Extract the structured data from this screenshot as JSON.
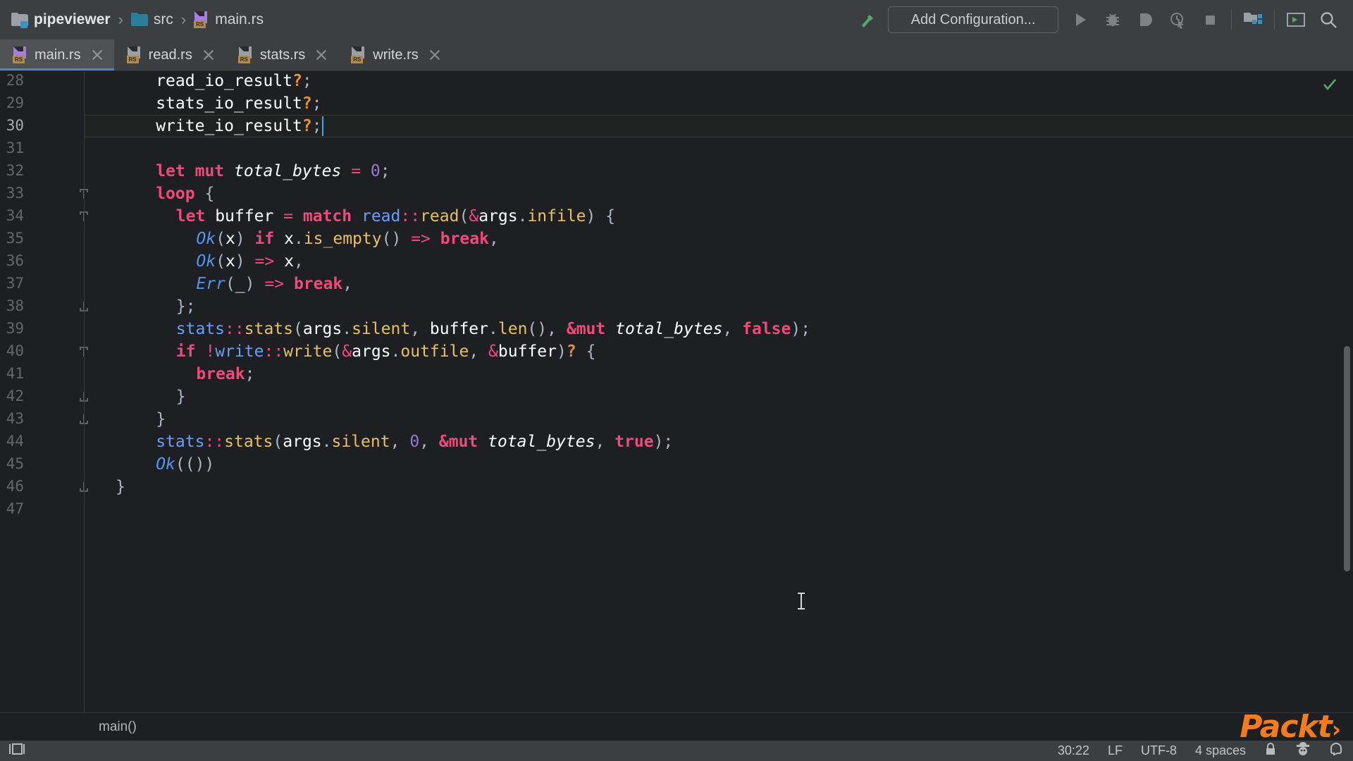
{
  "toolbar": {
    "breadcrumb": [
      {
        "label": "pipeviewer",
        "icon": "module-folder-icon",
        "bold": true
      },
      {
        "label": "src",
        "icon": "folder-icon",
        "bold": false
      },
      {
        "label": "main.rs",
        "icon": "rust-file-icon",
        "bold": false
      }
    ],
    "separator": "›",
    "run_config_label": "Add Configuration...",
    "icons": [
      "build-hammer-icon",
      "run-icon",
      "debug-icon",
      "run-coverage-icon",
      "profile-icon",
      "stop-icon",
      "project-structure-icon",
      "terminal-icon",
      "search-everywhere-icon"
    ]
  },
  "tabs": [
    {
      "label": "main.rs",
      "active": true,
      "icon": "rust-file-icon"
    },
    {
      "label": "read.rs",
      "active": false,
      "icon": "rust-file-icon"
    },
    {
      "label": "stats.rs",
      "active": false,
      "icon": "rust-file-icon"
    },
    {
      "label": "write.rs",
      "active": false,
      "icon": "rust-file-icon"
    }
  ],
  "editor": {
    "file_icon_label": "RS",
    "first_line": 28,
    "current_line": 30,
    "caret_position": "30:22",
    "breadcrumb_footer": "main()",
    "lines": [
      {
        "n": 28,
        "indent": 2,
        "partial_top": true,
        "tokens": [
          [
            "var",
            "read_io_result"
          ],
          [
            "q",
            "?"
          ],
          [
            "punc",
            ";"
          ]
        ]
      },
      {
        "n": 29,
        "indent": 2,
        "tokens": [
          [
            "var",
            "stats_io_result"
          ],
          [
            "q",
            "?"
          ],
          [
            "punc",
            ";"
          ]
        ]
      },
      {
        "n": 30,
        "indent": 2,
        "highlight": true,
        "caret_after": true,
        "tokens": [
          [
            "var",
            "write_io_result"
          ],
          [
            "q",
            "?"
          ],
          [
            "punc",
            ";"
          ]
        ]
      },
      {
        "n": 31,
        "indent": 0,
        "tokens": []
      },
      {
        "n": 32,
        "indent": 2,
        "tokens": [
          [
            "kw",
            "let"
          ],
          [
            "plain",
            " "
          ],
          [
            "kw",
            "mut"
          ],
          [
            "plain",
            " "
          ],
          [
            "vari",
            "total_bytes"
          ],
          [
            "plain",
            " "
          ],
          [
            "op",
            "="
          ],
          [
            "plain",
            " "
          ],
          [
            "num",
            "0"
          ],
          [
            "punc",
            ";"
          ]
        ]
      },
      {
        "n": 33,
        "indent": 2,
        "fold": "start",
        "tokens": [
          [
            "kw",
            "loop"
          ],
          [
            "plain",
            " "
          ],
          [
            "punc",
            "{"
          ]
        ]
      },
      {
        "n": 34,
        "indent": 3,
        "fold": "start",
        "tokens": [
          [
            "kw",
            "let"
          ],
          [
            "plain",
            " "
          ],
          [
            "var",
            "buffer"
          ],
          [
            "plain",
            " "
          ],
          [
            "op",
            "="
          ],
          [
            "plain",
            " "
          ],
          [
            "kw",
            "match"
          ],
          [
            "plain",
            " "
          ],
          [
            "mod",
            "read"
          ],
          [
            "op",
            "::"
          ],
          [
            "fn",
            "read"
          ],
          [
            "punc",
            "("
          ],
          [
            "op",
            "&"
          ],
          [
            "var",
            "args"
          ],
          [
            "punc",
            "."
          ],
          [
            "fld",
            "infile"
          ],
          [
            "punc",
            ")"
          ],
          [
            "plain",
            " "
          ],
          [
            "punc",
            "{"
          ]
        ]
      },
      {
        "n": 35,
        "indent": 4,
        "tokens": [
          [
            "typ",
            "Ok"
          ],
          [
            "punc",
            "("
          ],
          [
            "var",
            "x"
          ],
          [
            "punc",
            ")"
          ],
          [
            "plain",
            " "
          ],
          [
            "kw",
            "if"
          ],
          [
            "plain",
            " "
          ],
          [
            "var",
            "x"
          ],
          [
            "punc",
            "."
          ],
          [
            "fn",
            "is_empty"
          ],
          [
            "punc",
            "()"
          ],
          [
            "plain",
            " "
          ],
          [
            "op",
            "=>"
          ],
          [
            "plain",
            " "
          ],
          [
            "kw",
            "break"
          ],
          [
            "punc",
            ","
          ]
        ]
      },
      {
        "n": 36,
        "indent": 4,
        "tokens": [
          [
            "typ",
            "Ok"
          ],
          [
            "punc",
            "("
          ],
          [
            "var",
            "x"
          ],
          [
            "punc",
            ")"
          ],
          [
            "plain",
            " "
          ],
          [
            "op",
            "=>"
          ],
          [
            "plain",
            " "
          ],
          [
            "var",
            "x"
          ],
          [
            "punc",
            ","
          ]
        ]
      },
      {
        "n": 37,
        "indent": 4,
        "tokens": [
          [
            "typ",
            "Err"
          ],
          [
            "punc",
            "("
          ],
          [
            "var",
            "_"
          ],
          [
            "punc",
            ")"
          ],
          [
            "plain",
            " "
          ],
          [
            "op",
            "=>"
          ],
          [
            "plain",
            " "
          ],
          [
            "kw",
            "break"
          ],
          [
            "punc",
            ","
          ]
        ]
      },
      {
        "n": 38,
        "indent": 3,
        "fold": "end",
        "tokens": [
          [
            "punc",
            "};"
          ]
        ]
      },
      {
        "n": 39,
        "indent": 3,
        "tokens": [
          [
            "mod",
            "stats"
          ],
          [
            "op",
            "::"
          ],
          [
            "fn",
            "stats"
          ],
          [
            "punc",
            "("
          ],
          [
            "var",
            "args"
          ],
          [
            "punc",
            "."
          ],
          [
            "fld",
            "silent"
          ],
          [
            "punc",
            ","
          ],
          [
            "plain",
            " "
          ],
          [
            "var",
            "buffer"
          ],
          [
            "punc",
            "."
          ],
          [
            "fn",
            "len"
          ],
          [
            "punc",
            "()"
          ],
          [
            "punc",
            ","
          ],
          [
            "plain",
            " "
          ],
          [
            "kw",
            "&mut"
          ],
          [
            "plain",
            " "
          ],
          [
            "vari",
            "total_bytes"
          ],
          [
            "punc",
            ","
          ],
          [
            "plain",
            " "
          ],
          [
            "kw",
            "false"
          ],
          [
            "punc",
            ");"
          ]
        ]
      },
      {
        "n": 40,
        "indent": 3,
        "fold": "start",
        "tokens": [
          [
            "kw",
            "if"
          ],
          [
            "plain",
            " "
          ],
          [
            "op",
            "!"
          ],
          [
            "mod",
            "write"
          ],
          [
            "op",
            "::"
          ],
          [
            "fn",
            "write"
          ],
          [
            "punc",
            "("
          ],
          [
            "op",
            "&"
          ],
          [
            "var",
            "args"
          ],
          [
            "punc",
            "."
          ],
          [
            "fld",
            "outfile"
          ],
          [
            "punc",
            ","
          ],
          [
            "plain",
            " "
          ],
          [
            "op",
            "&"
          ],
          [
            "var",
            "buffer"
          ],
          [
            "punc",
            ")"
          ],
          [
            "q",
            "?"
          ],
          [
            "plain",
            " "
          ],
          [
            "punc",
            "{"
          ]
        ]
      },
      {
        "n": 41,
        "indent": 4,
        "tokens": [
          [
            "kw",
            "break"
          ],
          [
            "punc",
            ";"
          ]
        ]
      },
      {
        "n": 42,
        "indent": 3,
        "fold": "end",
        "tokens": [
          [
            "punc",
            "}"
          ]
        ]
      },
      {
        "n": 43,
        "indent": 2,
        "fold": "end",
        "tokens": [
          [
            "punc",
            "}"
          ]
        ]
      },
      {
        "n": 44,
        "indent": 2,
        "tokens": [
          [
            "mod",
            "stats"
          ],
          [
            "op",
            "::"
          ],
          [
            "fn",
            "stats"
          ],
          [
            "punc",
            "("
          ],
          [
            "var",
            "args"
          ],
          [
            "punc",
            "."
          ],
          [
            "fld",
            "silent"
          ],
          [
            "punc",
            ","
          ],
          [
            "plain",
            " "
          ],
          [
            "num",
            "0"
          ],
          [
            "punc",
            ","
          ],
          [
            "plain",
            " "
          ],
          [
            "kw",
            "&mut"
          ],
          [
            "plain",
            " "
          ],
          [
            "vari",
            "total_bytes"
          ],
          [
            "punc",
            ","
          ],
          [
            "plain",
            " "
          ],
          [
            "kw",
            "true"
          ],
          [
            "punc",
            ");"
          ]
        ]
      },
      {
        "n": 45,
        "indent": 2,
        "tokens": [
          [
            "typ",
            "Ok"
          ],
          [
            "punc",
            "(())"
          ]
        ]
      },
      {
        "n": 46,
        "indent": 0,
        "fold": "end",
        "tokens": [
          [
            "punc",
            "}"
          ]
        ]
      },
      {
        "n": 47,
        "indent": 0,
        "tokens": []
      }
    ]
  },
  "statusbar": {
    "caret": "30:22",
    "line_separator": "LF",
    "encoding": "UTF-8",
    "indent": "4 spaces",
    "icons": [
      "layout-icon",
      "lock-icon",
      "mascot-icon",
      "notifications-icon"
    ]
  },
  "watermark": {
    "text": "Packt",
    "suffix": "›",
    "color": "#f47b20"
  },
  "colors": {
    "toolbar_bg": "#3c3f41",
    "editor_bg": "#1e1f22",
    "tab_active_bg": "#4e5254",
    "tab_underline": "#4a88c7",
    "keyword": "#f04a7a",
    "function": "#e8bf6a",
    "module": "#6a9ff5",
    "type": "#5394ec",
    "number": "#9876d3",
    "question": "#e8913a",
    "text": "#e8e8e8",
    "line_number": "#64686b",
    "caret": "#4a9ff5"
  }
}
